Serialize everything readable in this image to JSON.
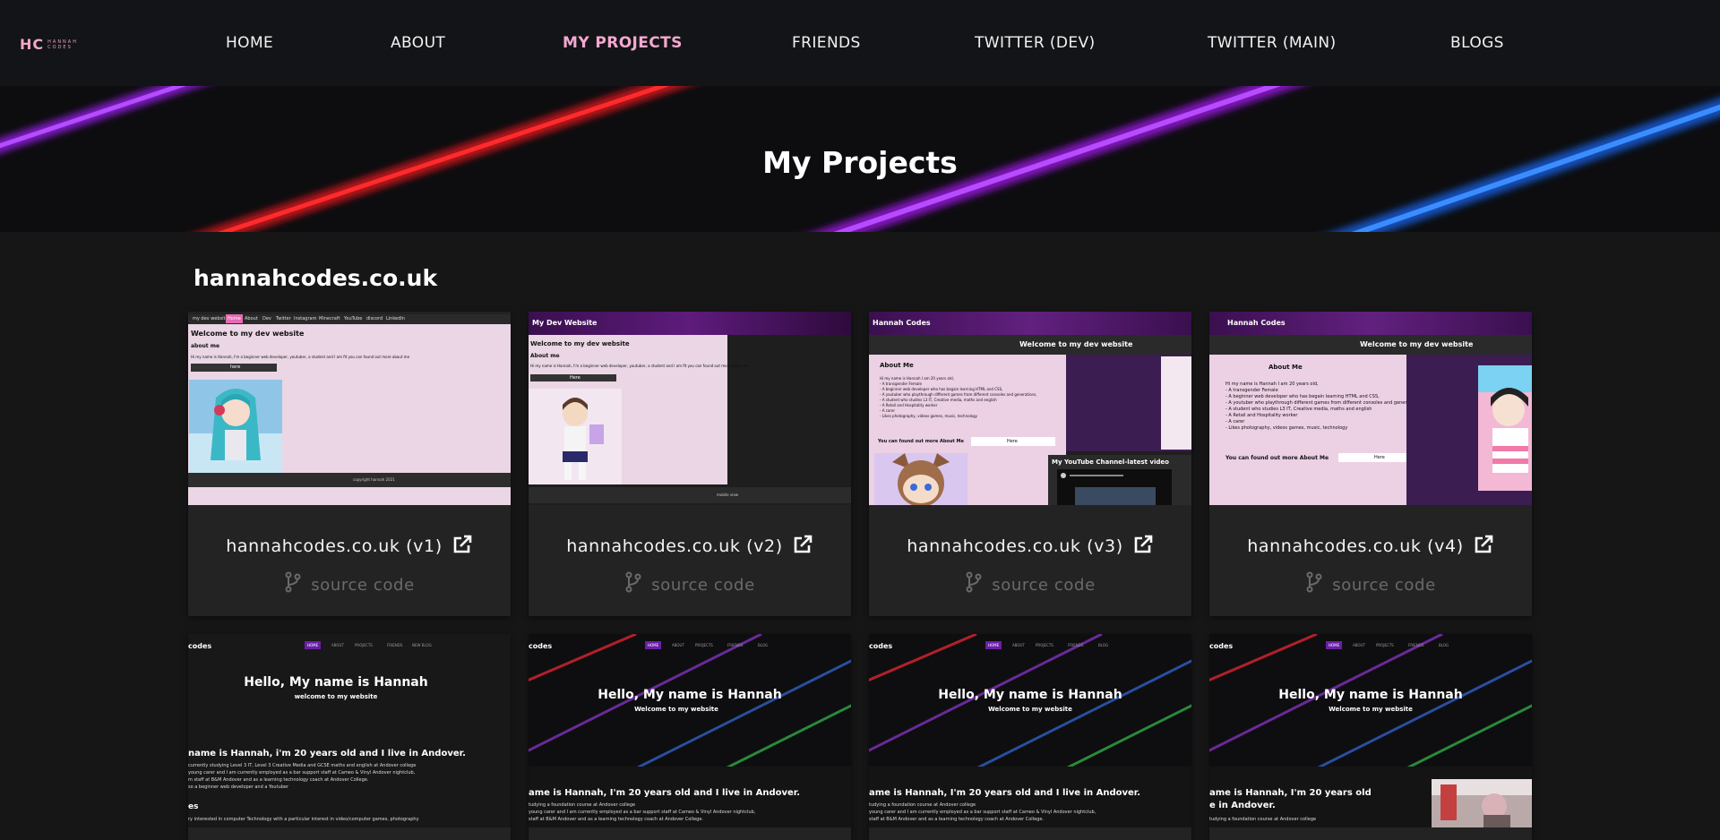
{
  "logo": {
    "mark": "HC",
    "line1": "HANNAH",
    "line2": "CODES"
  },
  "nav": [
    {
      "label": "HOME",
      "active": false
    },
    {
      "label": "ABOUT",
      "active": false
    },
    {
      "label": "MY PROJECTS",
      "active": true
    },
    {
      "label": "FRIENDS",
      "active": false
    },
    {
      "label": "TWITTER (DEV)",
      "active": false
    },
    {
      "label": "TWITTER (MAIN)",
      "active": false
    },
    {
      "label": "BLOGS",
      "active": false
    }
  ],
  "hero": {
    "title": "My Projects"
  },
  "section": {
    "title": "hannahcodes.co.uk"
  },
  "projects": [
    {
      "link_label": "hannahcodes.co.uk (v1)",
      "source_label": "source code",
      "preview": {
        "nav": [
          "my dev website",
          "Home",
          "About",
          "Dev",
          "Twitter",
          "Instagram",
          "Minecraft",
          "YouTube",
          "discord",
          "LinkedIn"
        ],
        "heading": "Welcome to my dev website",
        "sub": "about me",
        "body": "Hi my name is Hannah, I'm a beginner web developer, youtuber, a student and I am fit you can found out more about me",
        "button": "here",
        "footer": "copyright hannah 2021"
      }
    },
    {
      "link_label": "hannahcodes.co.uk (v2)",
      "source_label": "source code",
      "preview": {
        "header": "My Dev Website",
        "heading": "Welcome to my dev website",
        "sub": "About me",
        "body": "Hi my name is Hannah, I'm a beginner web developer, youtuber, a student and I am fit you can found out more about me",
        "button": "Here",
        "footer": "mobile view"
      }
    },
    {
      "link_label": "hannahcodes.co.uk (v3)",
      "source_label": "source code",
      "preview": {
        "header": "Hannah Codes",
        "banner": "Welcome to my dev website",
        "heading": "About Me",
        "lines": [
          "Hi my name is Hannah I am 20 years old,",
          "- A transgender Female",
          "- A beginner web developer who has begain learning HTML and CSS,",
          "- A youtuber who playthrough different games from different consoles and generations,",
          "- A student who studies L3 IT, Creative media, maths and english",
          "- A Retail and Hospitality worker",
          "- A carer",
          "- Likes photography, videos games, music, technology"
        ],
        "cta": "You can found out more About Me",
        "button": "Here",
        "video": "My YouTube Channel-latest video"
      }
    },
    {
      "link_label": "hannahcodes.co.uk (v4)",
      "source_label": "source code",
      "preview": {
        "header": "Hannah Codes",
        "banner": "Welcome to my dev website",
        "heading": "About Me",
        "lines": [
          "Hi my name is Hannah I am 20 years old,",
          "- A transgender Female",
          "- A beginner web developer who has begain learning HTML and CSS,",
          "- A youtuber who playthrough different games from different consoles and generations,",
          "- A student who studies L3 IT, Creative media, maths and english",
          "- A Retail and Hospitality worker",
          "- A carer",
          "- Likes photography, videos games, music, technology"
        ],
        "cta": "You can found out more About Me",
        "button": "Here"
      }
    }
  ],
  "projects_row2": [
    {
      "brand": "codes",
      "nav": [
        "HOME",
        "ABOUT",
        "PROJECTS",
        "FRIENDS",
        "NEW BLOG"
      ],
      "heading": "Hello, My name is Hannah",
      "sub": "welcome to my website",
      "intro": "name is Hannah, i'm 20 years old and I live in Andover.",
      "body": [
        "currently studying Level 3 IT, Level 3 Creative Media and GCSE maths and english at Andover college",
        "young carer and I am currently employed as a bar support staff at Cameo & Vinyl Andover nightclub,",
        "m staff at B&M Andover and as a learning technology coach at Andover College.",
        "so a beginner web developer and a Youtuber"
      ],
      "section2": "es",
      "body2": "ry interested in computer Technology with a particular interest in video/computer games, photography"
    },
    {
      "brand": "codes",
      "nav": [
        "HOME",
        "ABOUT",
        "PROJECTS",
        "FRIENDS",
        "BLOG"
      ],
      "heading": "Hello, My name is Hannah",
      "sub": "Welcome to my website",
      "intro": "ame is Hannah, I'm 20 years old and I live in Andover.",
      "body": [
        "tudying a foundation course at Andover college",
        "young carer and I am currently employed as a bar support staff at Cameo & Vinyl Andover nightclub,",
        "staff at B&M Andover and as a learning technology coach at Andover College."
      ]
    },
    {
      "brand": "codes",
      "nav": [
        "HOME",
        "ABOUT",
        "PROJECTS",
        "FRIENDS",
        "BLOG"
      ],
      "heading": "Hello, My name is Hannah",
      "sub": "Welcome to my website",
      "intro": "ame is Hannah, I'm 20 years old and I live in Andover.",
      "body": [
        "tudying a foundation course at Andover college",
        "young carer and I am currently employed as a bar support staff at Cameo & Vinyl Andover nightclub,",
        "staff at B&M Andover and as a learning technology coach at Andover College."
      ]
    },
    {
      "brand": "codes",
      "nav": [
        "HOME",
        "ABOUT",
        "PROJECTS",
        "FRIENDS",
        "BLOG"
      ],
      "heading": "Hello, My name is Hannah",
      "sub": "Welcome to my website",
      "intro": "ame is Hannah, I'm 20 years old",
      "intro2": "e in Andover.",
      "body": [
        "tudying a foundation course at Andover college"
      ]
    }
  ],
  "colors": {
    "accent_pink": "#f3a8d0",
    "nav_bg": "#131417",
    "page_bg": "#161616",
    "card_bg": "#232323",
    "muted": "#6a6a6a"
  }
}
